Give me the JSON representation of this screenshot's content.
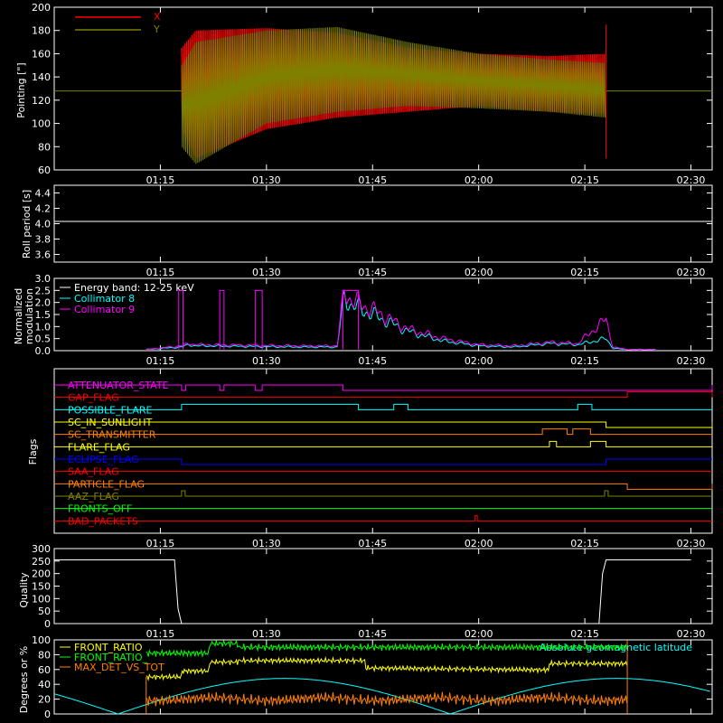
{
  "colors": {
    "background": "#000000",
    "axis": "#ffffff",
    "x_series": "#ff0000",
    "y_series": "#808000",
    "collimator8": "#00ffff",
    "collimator9": "#ff00ff",
    "green": "#00ff00",
    "yellow": "#ffff00",
    "orange": "#ff8000",
    "cyan": "#00ffff",
    "magenta": "#ff00ff",
    "red": "#ff0000",
    "blue": "#0000ff"
  },
  "time_ticks": [
    "01:15",
    "01:30",
    "01:45",
    "02:00",
    "02:15",
    "02:30"
  ],
  "chart_data": [
    {
      "id": "pointing",
      "type": "line",
      "ylabel": "Pointing [\"]",
      "ylim": [
        60,
        200
      ],
      "yticks": [
        "60",
        "80",
        "100",
        "120",
        "140",
        "160",
        "180",
        "200"
      ],
      "series": [
        {
          "name": "X",
          "color": "#ff0000",
          "envelope": {
            "x_minutes": [
              78,
              80,
              90,
              100,
              110,
              120,
              130,
              138
            ],
            "upper": [
              165,
              180,
              182,
              178,
              165,
              160,
              158,
              160
            ],
            "lower": [
              95,
              70,
              95,
              105,
              110,
              115,
              110,
              108
            ]
          }
        },
        {
          "name": "Y",
          "color": "#808000",
          "envelope": {
            "x_minutes": [
              78,
              80,
              90,
              100,
              110,
              120,
              130,
              138
            ],
            "upper": [
              150,
              170,
              180,
              183,
              170,
              160,
              155,
              152
            ],
            "lower": [
              80,
              65,
              100,
              110,
              115,
              113,
              110,
              105
            ]
          }
        }
      ],
      "baseline": 128
    },
    {
      "id": "roll_period",
      "type": "line",
      "ylabel": "Roll period [s]",
      "ylim": [
        3.5,
        4.5
      ],
      "yticks": [
        "3.6",
        "3.8",
        "4.0",
        "4.2",
        "4.4"
      ],
      "value": 4.03
    },
    {
      "id": "modulation",
      "type": "line",
      "ylabel": [
        "Normalized",
        "modulation"
      ],
      "ylim": [
        0,
        3
      ],
      "yticks": [
        "0.0",
        "0.5",
        "1.0",
        "1.5",
        "2.0",
        "2.5",
        "3.0"
      ],
      "legend": [
        "Energy band: 12-25 keV",
        "Collimator 8",
        "Collimator 9"
      ],
      "series": [
        {
          "name": "Collimator 8",
          "color": "#00ffff",
          "x_minutes": [
            73,
            78,
            79,
            80,
            95,
            100,
            101,
            102,
            105,
            110,
            115,
            120,
            125,
            130,
            134,
            138,
            139,
            141,
            145
          ],
          "values": [
            0.05,
            0.15,
            0.25,
            0.2,
            0.15,
            0.15,
            2.3,
            1.9,
            1.5,
            0.8,
            0.4,
            0.2,
            0.15,
            0.3,
            0.25,
            0.5,
            0.1,
            0.05,
            0.05
          ]
        },
        {
          "name": "Collimator 9",
          "color": "#ff00ff",
          "x_minutes": [
            73,
            78,
            79,
            80,
            95,
            100,
            101,
            102,
            105,
            110,
            115,
            120,
            125,
            130,
            134,
            138,
            139,
            141,
            145
          ],
          "values": [
            0.05,
            0.2,
            0.3,
            0.25,
            0.2,
            0.2,
            2.5,
            2.1,
            1.7,
            0.9,
            0.5,
            0.25,
            0.2,
            0.35,
            0.3,
            1.3,
            0.15,
            0.05,
            0.05
          ]
        }
      ]
    },
    {
      "id": "flags",
      "type": "line",
      "ylabel": "Flags",
      "rows": [
        {
          "label": "ATTENUATOR_STATE",
          "color": "#ff00ff"
        },
        {
          "label": "GAP_FLAG",
          "color": "#ff0000"
        },
        {
          "label": "POSSIBLE_FLARE",
          "color": "#00ffff"
        },
        {
          "label": "SC_IN_SUNLIGHT",
          "color": "#ffff00"
        },
        {
          "label": "SC_TRANSMITTER",
          "color": "#ff8000"
        },
        {
          "label": "FLARE_FLAG",
          "color": "#ffff00"
        },
        {
          "label": "ECLIPSE_FLAG",
          "color": "#0000ff"
        },
        {
          "label": "SAA_FLAG",
          "color": "#ff0000"
        },
        {
          "label": "PARTICLE_FLAG",
          "color": "#ff8000"
        },
        {
          "label": "AAZ_FLAG",
          "color": "#808000"
        },
        {
          "label": "FRONTS_OFF",
          "color": "#00ff00"
        },
        {
          "label": "BAD_PACKETS",
          "color": "#ff0000"
        }
      ]
    },
    {
      "id": "quality",
      "type": "line",
      "ylabel": "Quality",
      "ylim": [
        0,
        300
      ],
      "yticks": [
        "0",
        "50",
        "100",
        "150",
        "200",
        "250",
        "300"
      ],
      "x_minutes": [
        60,
        77,
        77.5,
        78,
        137,
        137.5,
        138,
        150
      ],
      "values": [
        255,
        255,
        60,
        0,
        0,
        200,
        255,
        255
      ]
    },
    {
      "id": "ratios",
      "type": "line",
      "ylabel": "Degrees or %",
      "ylim": [
        0,
        100
      ],
      "yticks": [
        "0",
        "20",
        "40",
        "60",
        "80",
        "100"
      ],
      "legend": [
        "FRONT_RATIO",
        "FRONT_RATIO_",
        "MAX_DET_VS_TOT"
      ],
      "annotation": "Absolute geomagnetic latitude",
      "series": [
        {
          "name": "FRONT_RATIO",
          "color": "#ffff00"
        },
        {
          "name": "FRONT_RATIO_",
          "color": "#00ff00"
        },
        {
          "name": "MAX_DET_VS_TOT",
          "color": "#ff8000"
        },
        {
          "name": "Absolute geomagnetic latitude",
          "color": "#00ffff"
        }
      ]
    }
  ]
}
